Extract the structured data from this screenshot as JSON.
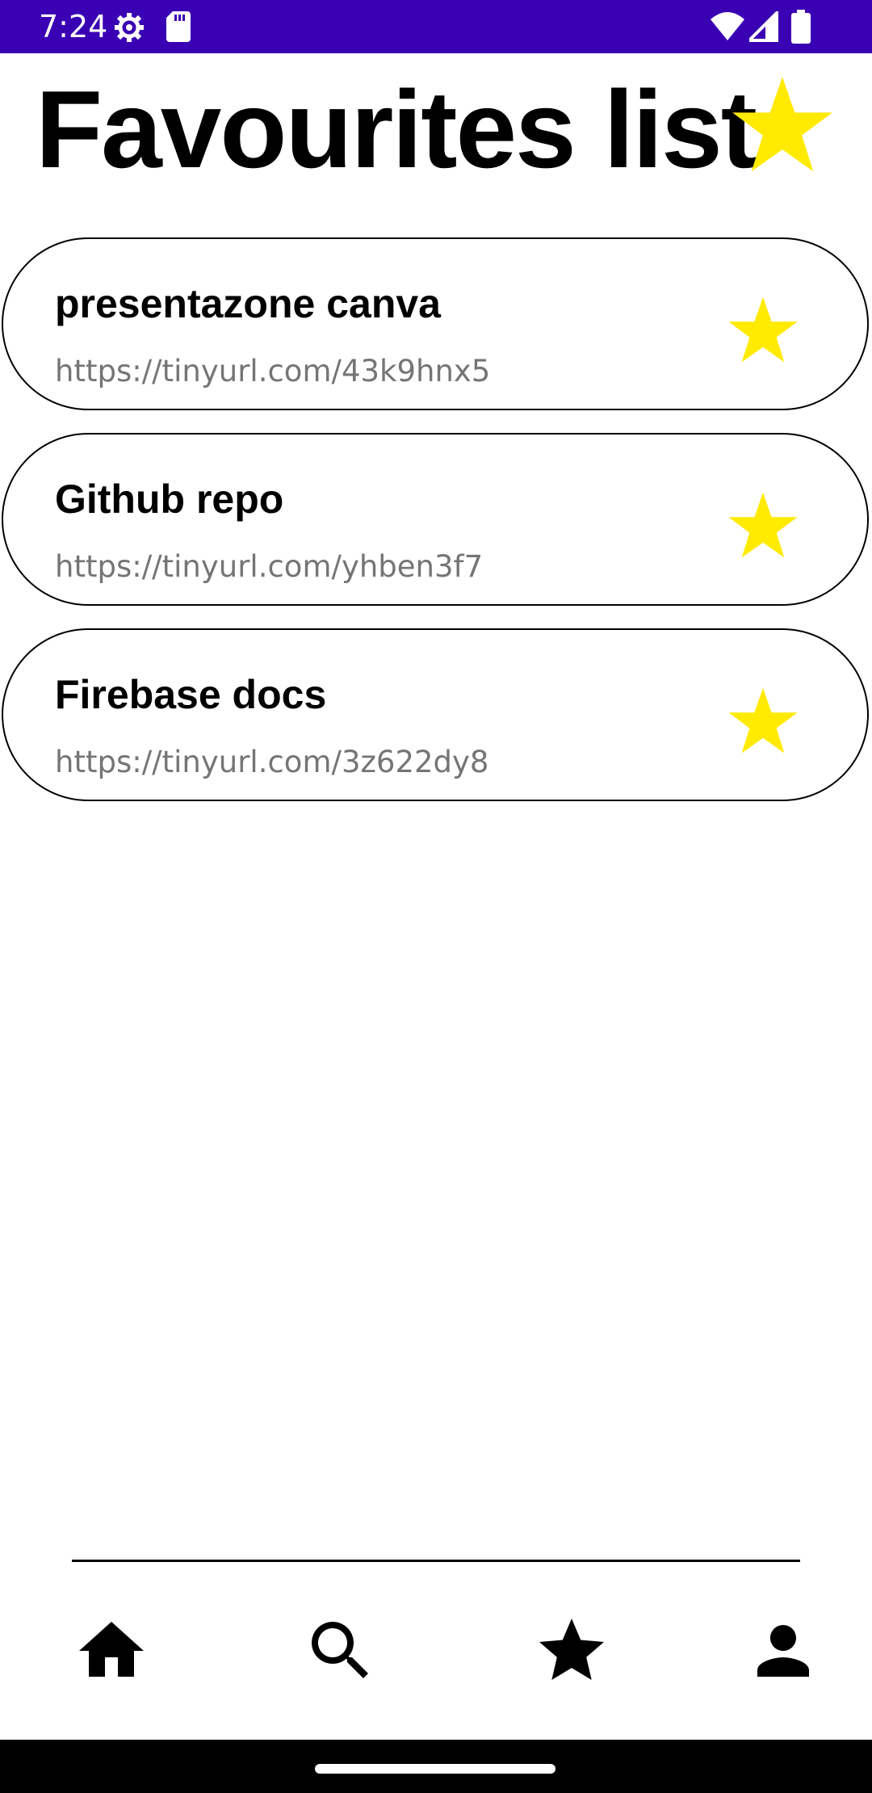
{
  "status_bar": {
    "time": "7:24",
    "icons_left": [
      "settings-icon",
      "sd-card-icon"
    ],
    "icons_right": [
      "wifi-icon",
      "cell-signal-icon",
      "battery-icon"
    ],
    "background": "#3a00b3"
  },
  "header": {
    "title": "Favourites list",
    "title_icon": "star-icon",
    "star_color": "#ffea00"
  },
  "favourites": [
    {
      "name": "presentazone canva",
      "url": "https://tinyurl.com/43k9hnx5",
      "icon": "star-icon"
    },
    {
      "name": "Github repo",
      "url": "https://tinyurl.com/yhben3f7",
      "icon": "star-icon"
    },
    {
      "name": "Firebase docs",
      "url": "https://tinyurl.com/3z622dy8",
      "icon": "star-icon"
    }
  ],
  "bottom_nav": {
    "items": [
      "home-icon",
      "search-icon",
      "star-icon",
      "person-icon"
    ]
  }
}
